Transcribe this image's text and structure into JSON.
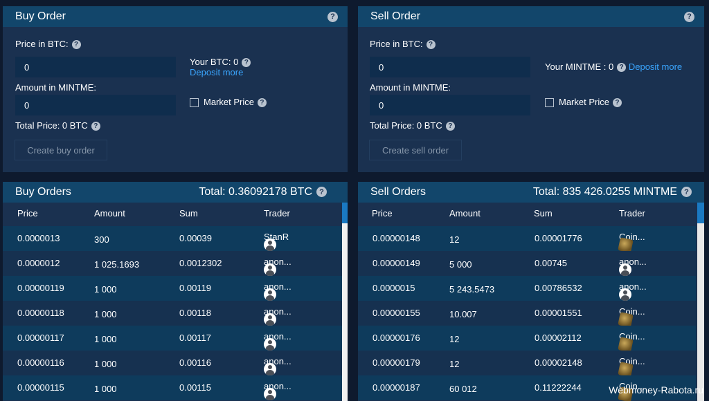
{
  "buy_order": {
    "title": "Buy Order",
    "price_label": "Price in BTC:",
    "price_value": "0",
    "amount_label": "Amount in MINTME:",
    "amount_value": "0",
    "total_label": "Total Price: 0 BTC",
    "balance_label": "Your BTC: 0",
    "deposit_link": "Deposit more",
    "market_price_label": "Market Price",
    "create_button": "Create buy order"
  },
  "sell_order": {
    "title": "Sell Order",
    "price_label": "Price in BTC:",
    "price_value": "0",
    "amount_label": "Amount in MINTME:",
    "amount_value": "0",
    "total_label": "Total Price: 0 BTC",
    "balance_label": "Your MINTME : 0",
    "deposit_link": "Deposit more",
    "market_price_label": "Market Price",
    "create_button": "Create sell order"
  },
  "buy_orders": {
    "title": "Buy Orders",
    "total": "Total: 0.36092178 BTC",
    "columns": [
      "Price",
      "Amount",
      "Sum",
      "Trader"
    ],
    "rows": [
      {
        "price": "0.0000013",
        "amount": "300",
        "sum": "0.00039",
        "trader": "StanR",
        "icon": "user-avatar-icon"
      },
      {
        "price": "0.0000012",
        "amount": "1 025.1693",
        "sum": "0.0012302",
        "trader": "anon...",
        "icon": "user-avatar-icon"
      },
      {
        "price": "0.00000119",
        "amount": "1 000",
        "sum": "0.00119",
        "trader": "anon...",
        "icon": "user-avatar-icon"
      },
      {
        "price": "0.00000118",
        "amount": "1 000",
        "sum": "0.00118",
        "trader": "anon...",
        "icon": "user-avatar-icon"
      },
      {
        "price": "0.00000117",
        "amount": "1 000",
        "sum": "0.00117",
        "trader": "anon...",
        "icon": "user-avatar-icon"
      },
      {
        "price": "0.00000116",
        "amount": "1 000",
        "sum": "0.00116",
        "trader": "anon...",
        "icon": "user-avatar-icon"
      },
      {
        "price": "0.00000115",
        "amount": "1 000",
        "sum": "0.00115",
        "trader": "anon...",
        "icon": "user-avatar-icon"
      }
    ]
  },
  "sell_orders": {
    "title": "Sell Orders",
    "total": "Total: 835 426.0255 MINTME",
    "columns": [
      "Price",
      "Amount",
      "Sum",
      "Trader"
    ],
    "rows": [
      {
        "price": "0.00000148",
        "amount": "12",
        "sum": "0.00001776",
        "trader": "Coin...",
        "icon": "coin-avatar-icon"
      },
      {
        "price": "0.00000149",
        "amount": "5 000",
        "sum": "0.00745",
        "trader": "anon...",
        "icon": "user-avatar-icon"
      },
      {
        "price": "0.0000015",
        "amount": "5 243.5473",
        "sum": "0.00786532",
        "trader": "anon...",
        "icon": "user-avatar-icon"
      },
      {
        "price": "0.00000155",
        "amount": "10.007",
        "sum": "0.00001551",
        "trader": "Coin...",
        "icon": "coin-avatar-icon"
      },
      {
        "price": "0.00000176",
        "amount": "12",
        "sum": "0.00002112",
        "trader": "Coin...",
        "icon": "coin-avatar-icon"
      },
      {
        "price": "0.00000179",
        "amount": "12",
        "sum": "0.00002148",
        "trader": "Coin...",
        "icon": "coin-avatar-icon"
      },
      {
        "price": "0.00000187",
        "amount": "60 012",
        "sum": "0.11222244",
        "trader": "Coin...",
        "icon": "coin-avatar-icon"
      }
    ]
  },
  "help_icon": "?",
  "watermark": "Webmoney-Rabota.ru",
  "colors": {
    "background": "#0e1a2e",
    "panel": "#1a3150",
    "header": "#12466b",
    "link": "#3aa6ff",
    "scroll_thumb": "#1a79c2"
  }
}
